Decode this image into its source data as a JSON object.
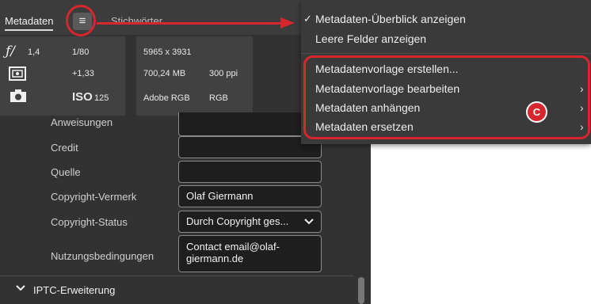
{
  "panel": {
    "tab_metadata": "Metadaten",
    "tab_keywords": "Stichwörter",
    "menu_button_glyph": "≡"
  },
  "camera": {
    "aperture": "1,4",
    "shutter": "1/80",
    "exposure_comp": "+1,33",
    "iso_label": "ISO",
    "iso_value": "125",
    "dimensions": "5965 x 3931",
    "filesize": "700,24 MB",
    "resolution": "300 ppi",
    "color_profile": "Adobe RGB",
    "color_mode": "RGB",
    "icons": [
      "aperture-f-icon",
      "metering-icon",
      "camera-icon"
    ]
  },
  "fields": {
    "anweisungen_label": "Anweisungen",
    "credit_label": "Credit",
    "quelle_label": "Quelle",
    "copyright_label": "Copyright-Vermerk",
    "copyright_value": "Olaf Giermann",
    "status_label": "Copyright-Status",
    "status_value": "Durch Copyright ges...",
    "terms_label": "Nutzungsbedingungen",
    "terms_line1": "Contact email@olaf-",
    "terms_line2": "giermann.de"
  },
  "section": {
    "iptc_label": "IPTC-Erweiterung"
  },
  "flyout": {
    "checkmark": "✓",
    "item_overview": "Metadaten-Überblick anzeigen",
    "item_empty": "Leere Felder anzeigen",
    "item_create": "Metadatenvorlage erstellen...",
    "item_edit": "Metadatenvorlage bearbeiten",
    "item_append": "Metadaten anhängen",
    "item_replace": "Metadaten ersetzen",
    "submenu_glyph": "›"
  },
  "annotation": {
    "marker": "C",
    "color": "#d7262c"
  }
}
